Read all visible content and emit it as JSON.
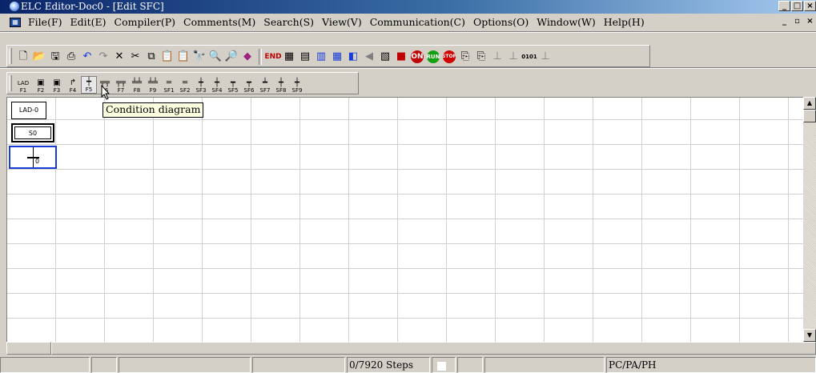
{
  "window": {
    "title": "ELC Editor-Doc0 - [Edit SFC]",
    "controls": [
      "_",
      "□",
      "×"
    ]
  },
  "menubar": {
    "items": [
      "File(F)",
      "Edit(E)",
      "Compiler(P)",
      "Comments(M)",
      "Search(S)",
      "View(V)",
      "Communication(C)",
      "Options(O)",
      "Window(W)",
      "Help(H)"
    ],
    "doc_controls": [
      "_",
      "▫",
      "×"
    ]
  },
  "toolbar_main": {
    "groups": [
      [
        "new-icon",
        "open-icon",
        "save-icon",
        "print-icon",
        "undo-icon",
        "redo-icon",
        "delete-icon",
        "cut-icon",
        "copy-icon",
        "paste-icon",
        "paste-special-icon",
        "find-icon",
        "zoom-in-icon",
        "zoom-out-icon",
        "settings-icon"
      ],
      [
        "end-icon",
        "ladder-grid-icon",
        "module-icon",
        "table-icon",
        "monitor-icon",
        "device-icon",
        "back-icon",
        "stepper-icon",
        "plc-icon",
        "online-icon",
        "run-icon",
        "stop-icon",
        "upload-icon",
        "download-icon",
        "contact-icon",
        "code-icon",
        "binary-icon",
        "output-icon"
      ]
    ],
    "text_glyphs": {
      "end-icon": "END",
      "online-icon": "ON",
      "run-icon": "RUN",
      "stop-icon": "STOP",
      "binary-icon": "0101"
    }
  },
  "toolbar_sfc": {
    "keys": [
      {
        "glyph": "LAD",
        "key": "F1",
        "name": "ladder-mode"
      },
      {
        "glyph": "▣",
        "key": "F2",
        "name": "step-initial"
      },
      {
        "glyph": "▣",
        "key": "F3",
        "name": "step"
      },
      {
        "glyph": "↱",
        "key": "F4",
        "name": "jump"
      },
      {
        "glyph": "┿",
        "key": "F5",
        "name": "condition-diagram"
      },
      {
        "glyph": "╤╤",
        "key": "F6",
        "name": "divergence"
      },
      {
        "glyph": "╤╤",
        "key": "F7",
        "name": "convergence"
      },
      {
        "glyph": "╧╧",
        "key": "F8",
        "name": "divergence-2"
      },
      {
        "glyph": "╧╧",
        "key": "F9",
        "name": "convergence-2"
      },
      {
        "glyph": "═",
        "key": "SF1",
        "name": "sf1"
      },
      {
        "glyph": "═",
        "key": "SF2",
        "name": "sf2"
      },
      {
        "glyph": "┿",
        "key": "SF3",
        "name": "sf3"
      },
      {
        "glyph": "┿",
        "key": "SF4",
        "name": "sf4"
      },
      {
        "glyph": "┯",
        "key": "SF5",
        "name": "sf5"
      },
      {
        "glyph": "┯",
        "key": "SF6",
        "name": "sf6"
      },
      {
        "glyph": "┷",
        "key": "SF7",
        "name": "sf7"
      },
      {
        "glyph": "┿",
        "key": "SF8",
        "name": "sf8"
      },
      {
        "glyph": "┿",
        "key": "SF9",
        "name": "sf9"
      }
    ]
  },
  "editor": {
    "lad_block": "LAD-0",
    "step_block": "S0",
    "transition_label": "0"
  },
  "tooltip": "Condition diagram",
  "statusbar": {
    "steps": "0/7920 Steps",
    "model": "PC/PA/PH"
  },
  "colors": {
    "title_gradient_start": "#0a246a",
    "title_gradient_end": "#a6caf0",
    "selection_border": "#1a3cd6",
    "tooltip_bg": "#ffffe1"
  }
}
